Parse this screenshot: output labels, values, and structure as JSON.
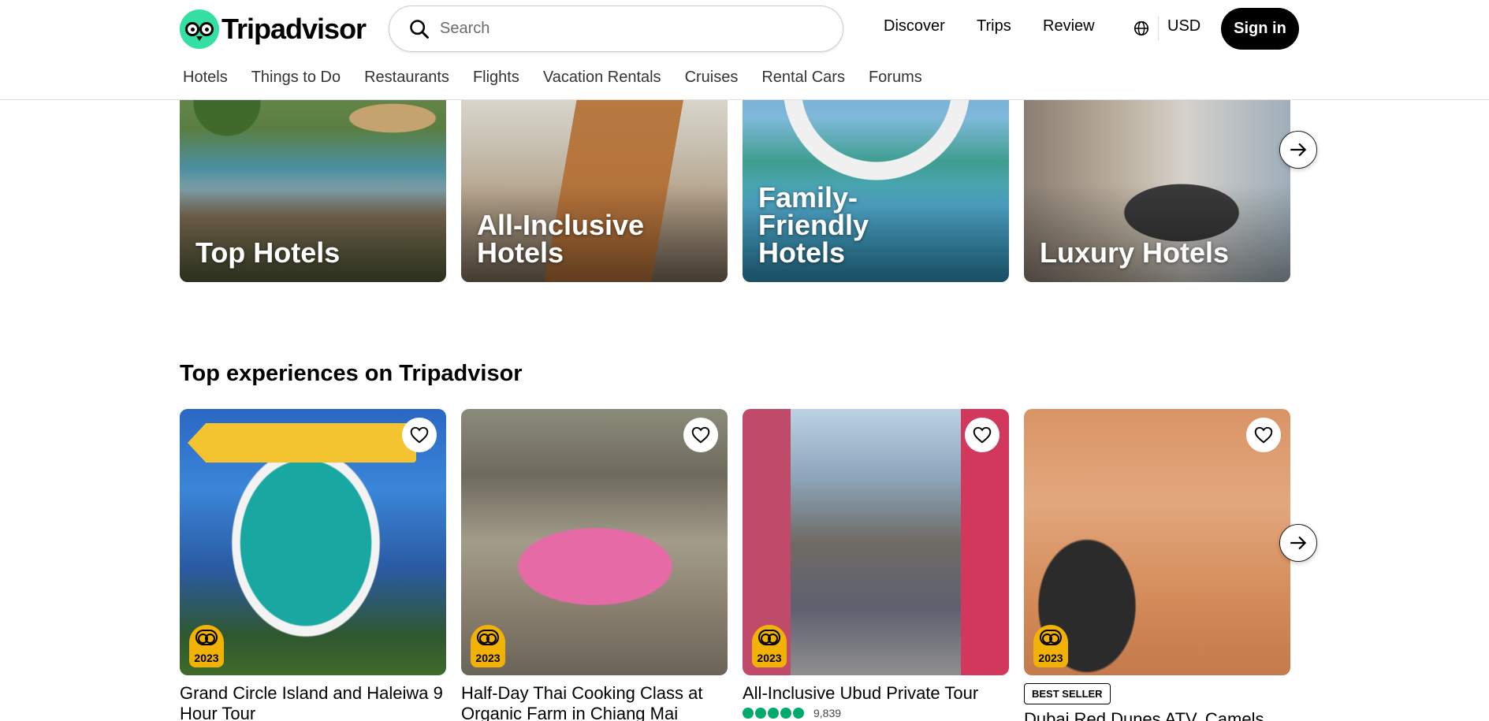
{
  "brand": {
    "name": "Tripadvisor"
  },
  "search": {
    "placeholder": "Search"
  },
  "topnav": {
    "discover": "Discover",
    "trips": "Trips",
    "review": "Review",
    "currency": "USD",
    "signin": "Sign in"
  },
  "subnav": [
    "Hotels",
    "Things to Do",
    "Restaurants",
    "Flights",
    "Vacation Rentals",
    "Cruises",
    "Rental Cars",
    "Forums"
  ],
  "categories": [
    {
      "label": "Top Hotels"
    },
    {
      "label": "All-Inclusive Hotels"
    },
    {
      "label": "Family-Friendly Hotels"
    },
    {
      "label": "Luxury Hotels"
    }
  ],
  "experiences": {
    "title": "Top experiences on Tripadvisor",
    "cards": [
      {
        "title": "Grand Circle Island and Haleiwa 9 Hour Tour",
        "award": "2023"
      },
      {
        "title": "Half-Day Thai Cooking Class at Organic Farm in Chiang Mai",
        "award": "2023"
      },
      {
        "title": "All-Inclusive Ubud Private Tour",
        "award": "2023",
        "rating": 5,
        "reviews": "9,839"
      },
      {
        "title": "Dubai Red Dunes ATV, Camels",
        "award": "2023",
        "badge": "BEST SELLER"
      }
    ]
  },
  "colors": {
    "brand_green": "#34e0a1",
    "rating_green": "#00aa6c",
    "award_gold": "#f2b203"
  }
}
